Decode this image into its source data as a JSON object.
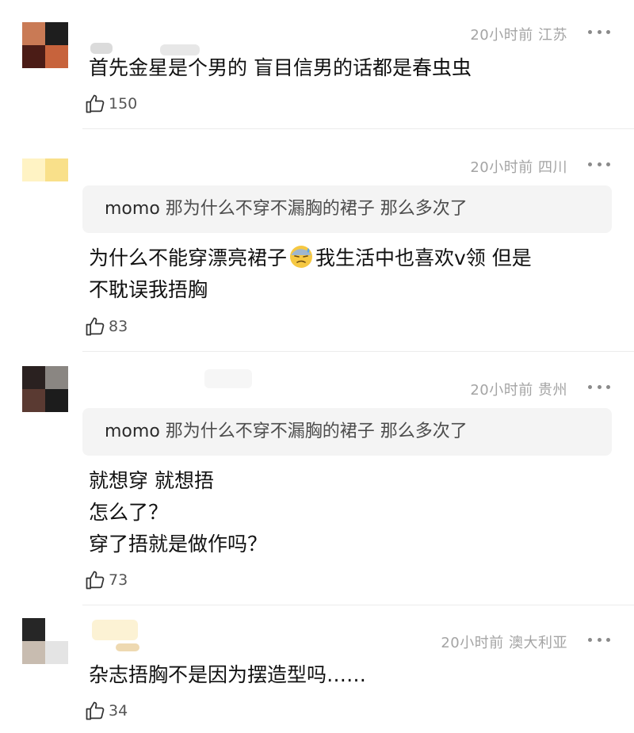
{
  "comments": [
    {
      "time": "20小时前",
      "location": "江苏",
      "reply_quote": null,
      "lines": [
        "首先金星是个男的 盲目信男的话都是春虫虫"
      ],
      "likes": "150",
      "avatar_colors": [
        "#c97a55",
        "#1e1e1e",
        "#4b1c16",
        "#c7633c"
      ]
    },
    {
      "time": "20小时前",
      "location": "四川",
      "reply_quote": {
        "user": "momo",
        "text": "那为什么不穿不漏胸的裙子  那么多次了"
      },
      "lines": [
        "为什么不能穿漂亮裙子",
        "我生活中也喜欢v领 但是",
        "不耽误我捂胸"
      ],
      "likes": "83",
      "avatar_colors": [
        "#fff3c4",
        "#f9e08a",
        "#ffffff",
        "#ffffff"
      ]
    },
    {
      "time": "20小时前",
      "location": "贵州",
      "reply_quote": {
        "user": "momo",
        "text": "那为什么不穿不漏胸的裙子  那么多次了"
      },
      "lines": [
        "就想穿 就想捂",
        "怎么了？",
        "穿了捂就是做作吗？"
      ],
      "likes": "73",
      "avatar_colors": [
        "#2a2120",
        "#8a8682",
        "#5a3a32",
        "#1c1c1c"
      ]
    },
    {
      "time": "20小时前",
      "location": "澳大利亚",
      "reply_quote": null,
      "lines": [
        "杂志捂胸不是因为摆造型吗……"
      ],
      "likes": "34",
      "avatar_colors": [
        "#262626",
        "#ffffff",
        "#c8bcb0",
        "#e4e4e4"
      ]
    }
  ],
  "icons": {
    "like": "thumbs-up-icon",
    "more": "more-dots-icon",
    "emoji": "sweat-face-emoji-icon"
  }
}
